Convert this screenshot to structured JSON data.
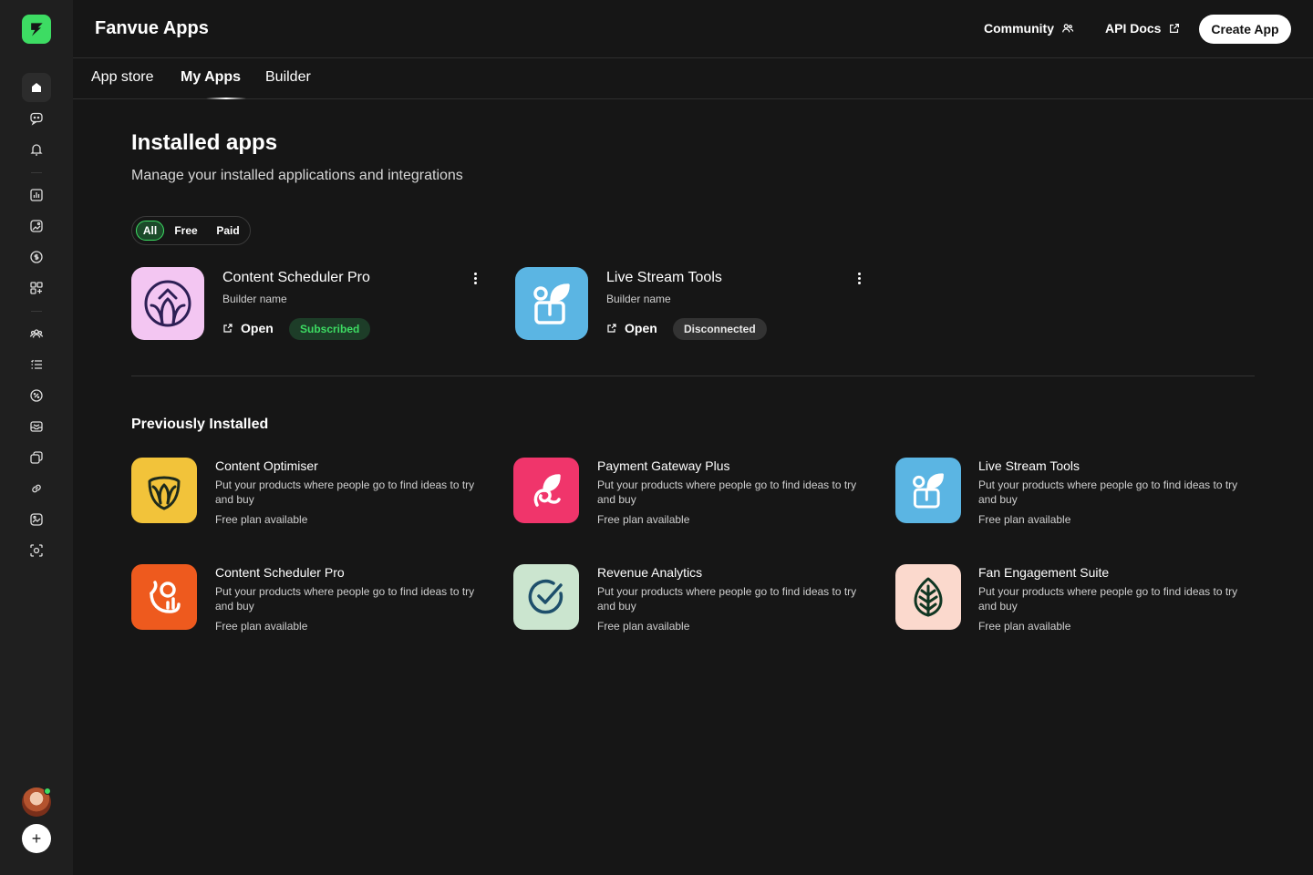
{
  "header": {
    "title": "Fanvue Apps",
    "community_label": "Community",
    "api_docs_label": "API Docs",
    "create_label": "Create App"
  },
  "tabs": [
    {
      "label": "App store"
    },
    {
      "label": "My Apps",
      "active": true
    },
    {
      "label": "Builder"
    }
  ],
  "page": {
    "title": "Installed apps",
    "subtitle": "Manage your installed applications and integrations"
  },
  "filters": [
    {
      "label": "All",
      "active": true
    },
    {
      "label": "Free"
    },
    {
      "label": "Paid"
    }
  ],
  "installed": [
    {
      "name": "Content Scheduler Pro",
      "builder": "Builder name",
      "open_label": "Open",
      "status": "Subscribed",
      "icon": "circle-chevron-icon",
      "color": "#f3c6f2"
    },
    {
      "name": "Live Stream Tools",
      "builder": "Builder name",
      "open_label": "Open",
      "status": "Disconnected",
      "icon": "plant-box-icon",
      "color": "#5bb5e3"
    }
  ],
  "previous": {
    "title": "Previously Installed",
    "items": [
      {
        "name": "Content Optimiser",
        "desc": "Put your products where people go to find ideas to try and buy",
        "plan": "Free plan available",
        "icon": "leaf-shield-icon",
        "color": "#f2c33a"
      },
      {
        "name": "Payment Gateway Plus",
        "desc": "Put your products where people go to find ideas to try and buy",
        "plan": "Free plan available",
        "icon": "swirl-leaf-icon",
        "color": "#f0356b"
      },
      {
        "name": "Live Stream Tools",
        "desc": "Put your products where people go to find ideas to try and buy",
        "plan": "Free plan available",
        "icon": "plant-box-icon",
        "color": "#5bb5e3"
      },
      {
        "name": "Content Scheduler Pro",
        "desc": "Put your products where people go to find ideas to try and buy",
        "plan": "Free plan available",
        "icon": "person-chart-icon",
        "color": "#ee5a1e"
      },
      {
        "name": "Revenue Analytics",
        "desc": "Put your products where people go to find ideas to try and buy",
        "plan": "Free plan available",
        "icon": "check-circle-icon",
        "color": "#cbe5cf"
      },
      {
        "name": "Fan Engagement Suite",
        "desc": "Put your products where people go to find ideas to try and buy",
        "plan": "Free plan available",
        "icon": "leaf-icon",
        "color": "#fbd9cd"
      }
    ]
  },
  "sidebar": {
    "icons": [
      "home-icon",
      "chat-icon",
      "bell-icon",
      "analytics-icon",
      "media-icon",
      "coin-icon",
      "apps-icon",
      "fans-icon",
      "lists-icon",
      "discount-icon",
      "messages-icon",
      "collections-icon",
      "links-icon",
      "gallery-icon",
      "scan-icon"
    ]
  }
}
